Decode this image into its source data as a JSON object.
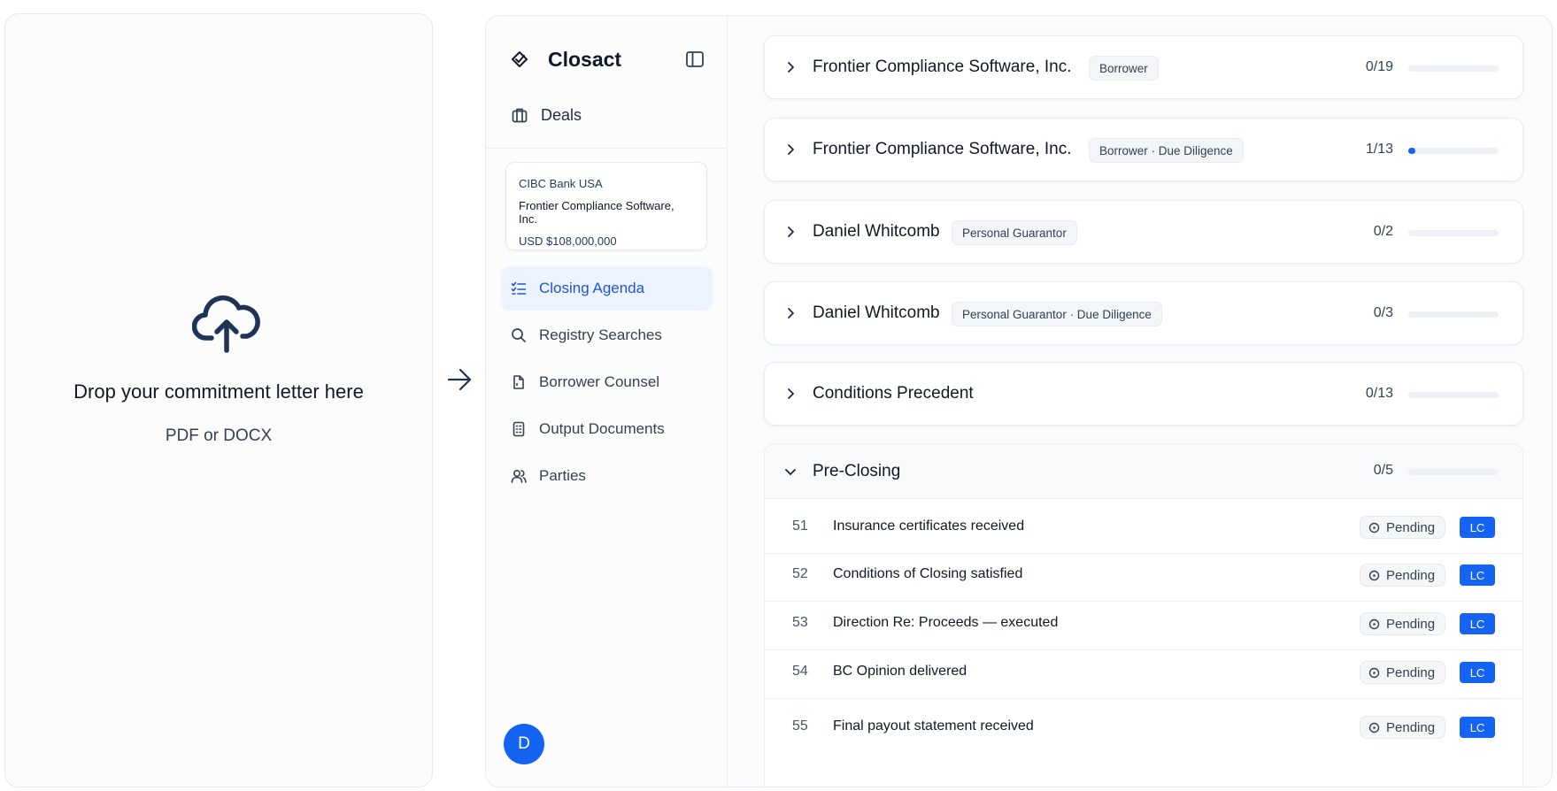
{
  "upload": {
    "title": "Drop your commitment letter here",
    "formats": "PDF or DOCX",
    "icon": "cloud-upload-icon"
  },
  "sidebar": {
    "brand": "Closact",
    "deals_label": "Deals",
    "deal_card": {
      "bank": "CIBC Bank USA",
      "borrower": "Frontier Compliance Software, Inc.",
      "amount": "USD $108,000,000"
    },
    "nav": [
      {
        "label": "Closing Agenda",
        "icon": "checklist-icon",
        "active": true
      },
      {
        "label": "Registry Searches",
        "icon": "search-icon",
        "active": false
      },
      {
        "label": "Borrower Counsel",
        "icon": "document-corner-icon",
        "active": false
      },
      {
        "label": "Output Documents",
        "icon": "document-list-icon",
        "active": false
      },
      {
        "label": "Parties",
        "icon": "users-icon",
        "active": false
      }
    ],
    "avatar_initial": "D"
  },
  "groups": [
    {
      "name": "Frontier Compliance Software, Inc.",
      "tag": "Borrower",
      "count": "0/19",
      "progress": 0.0
    },
    {
      "name": "Frontier Compliance Software, Inc.",
      "tag": "Borrower · Due Diligence",
      "count": "1/13",
      "progress": 0.077
    },
    {
      "name": "Daniel Whitcomb",
      "tag": "Personal Guarantor",
      "count": "0/2",
      "progress": 0.0
    },
    {
      "name": "Daniel Whitcomb",
      "tag": "Personal Guarantor · Due Diligence",
      "count": "0/3",
      "progress": 0.0
    },
    {
      "name": "Conditions Precedent",
      "tag": "",
      "count": "0/13",
      "progress": 0.0
    }
  ],
  "section": {
    "name": "Pre-Closing",
    "count": "0/5",
    "progress": 0.0,
    "items": [
      {
        "num": "51",
        "title": "Insurance certificates received",
        "status": "Pending",
        "owner": "LC"
      },
      {
        "num": "52",
        "title": "Conditions of Closing satisfied",
        "status": "Pending",
        "owner": "LC"
      },
      {
        "num": "53",
        "title": "Direction Re: Proceeds — executed",
        "status": "Pending",
        "owner": "LC"
      },
      {
        "num": "54",
        "title": "BC Opinion delivered",
        "status": "Pending",
        "owner": "LC"
      },
      {
        "num": "55",
        "title": "Final payout statement received",
        "status": "Pending",
        "owner": "LC"
      }
    ]
  },
  "colors": {
    "accent": "#1463f3",
    "active_nav_bg": "#eef4ff",
    "active_nav_text": "#1d55d8"
  }
}
